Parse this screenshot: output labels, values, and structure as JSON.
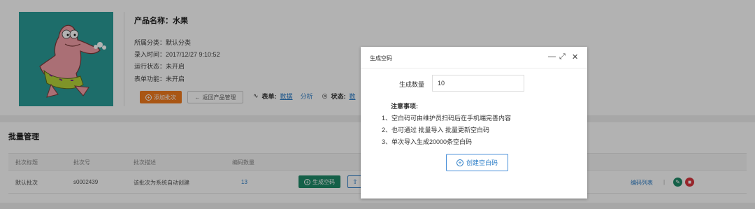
{
  "product": {
    "name_label": "产品名称：水果",
    "category": "所属分类：默认分类",
    "entry_time": "录入时间：2017/12/27 9:10:52",
    "run_status": "运行状态：未开启",
    "form_function": "表单功能：未开启",
    "add_batch_label": "添加批次",
    "back_label": "返回产品管理",
    "form_label": "表单:",
    "data_link": "数据",
    "analysis_link": "分析",
    "status_label": "状态:",
    "status_value": "数"
  },
  "batch": {
    "title": "批量管理",
    "columns": [
      "批次标题",
      "批次号",
      "批次描述",
      "编码数量"
    ],
    "rows": [
      {
        "title": "默认批次",
        "number": "s0002439",
        "description": "该批次为系统自动创建",
        "count": "13",
        "generate_label": "生成空码",
        "code_list_label": "编码列表",
        "separator": "|"
      }
    ]
  },
  "modal": {
    "title": "生成空码",
    "quantity_label": "生成数量",
    "quantity_value": "10",
    "notes_title": "注意事项:",
    "notes": [
      "1、空白码可由维护员扫码后在手机端完善内容",
      "2、也可通过 批量导入 批量更新空白码",
      "3、单次导入生成20000条空白码"
    ],
    "create_label": "创建空白码"
  },
  "colors": {
    "accent_orange": "#f37b1d",
    "accent_green": "#1d8a67",
    "link_blue": "#2a7cc7",
    "image_bg": "#2a9d98"
  }
}
